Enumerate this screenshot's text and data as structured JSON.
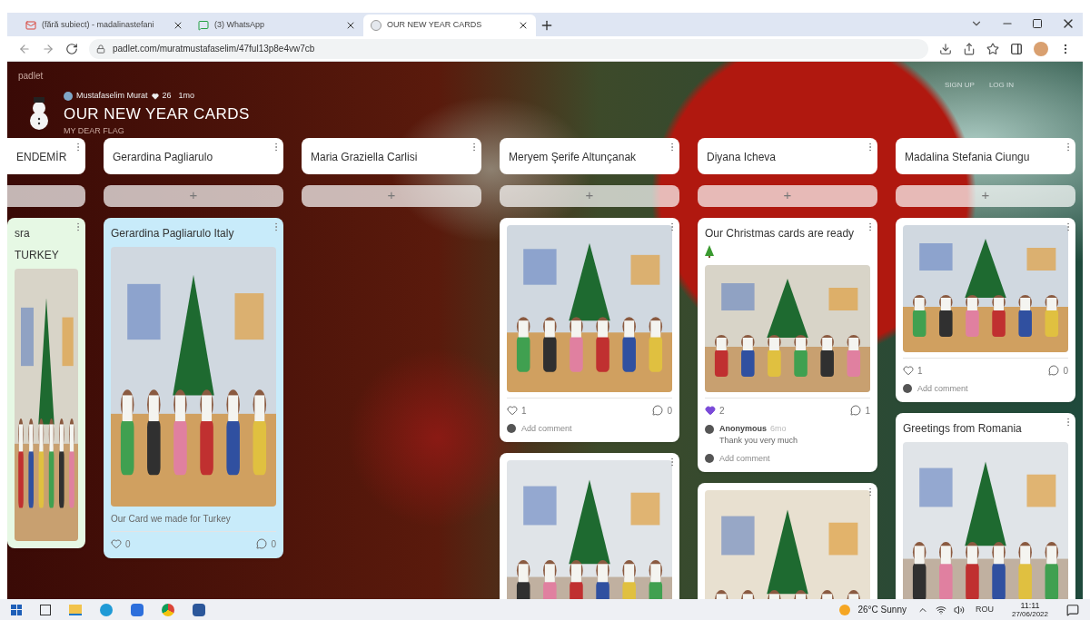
{
  "browser": {
    "tabs": [
      {
        "title": "(fără subiect) - madalinastefani",
        "selected": false,
        "kind": "mail"
      },
      {
        "title": "(3) WhatsApp",
        "selected": false,
        "kind": "chat"
      },
      {
        "title": "OUR NEW YEAR CARDS",
        "selected": true,
        "kind": "board"
      }
    ],
    "url": "padlet.com/muratmustafaselim/47ful13p8e4vw7cb"
  },
  "header": {
    "brand": "padlet",
    "author": "Mustafaselim Murat",
    "reactions": "26",
    "age": "1mo",
    "title": "OUR NEW YEAR CARDS",
    "subtitle": "MY DEAR FLAG",
    "actions": [
      "SIGN UP",
      "LOG IN"
    ]
  },
  "columns": [
    {
      "title": "ENDEMİR",
      "posts": [
        {
          "color": "#e6f8e4",
          "lines": [
            "sra",
            "TURKEY"
          ],
          "image": {
            "kind": "picture"
          }
        }
      ]
    },
    {
      "title": "Gerardina Pagliarulo",
      "add": "+",
      "posts": [
        {
          "color": "#c8ebfa",
          "title": "Gerardina Pagliarulo Italy",
          "image": {
            "kind": "picture"
          },
          "caption": "Our Card we made for Turkey",
          "likes": {
            "count": "0",
            "liked": false
          },
          "comments": "0"
        }
      ]
    },
    {
      "title": "Maria Graziella Carlisi",
      "add": "+"
    },
    {
      "title": "Meryem Şerife Altunçanak",
      "add": "+",
      "posts": [
        {
          "color": "#ffffff",
          "image": {
            "kind": "picture"
          },
          "likes": {
            "count": "1",
            "liked": false
          },
          "comments": "0",
          "add_comment": "Add comment"
        },
        {
          "color": "#ffffff",
          "image": {
            "kind": "picture"
          }
        }
      ]
    },
    {
      "title": "Diyana Icheva",
      "add": "+",
      "posts": [
        {
          "color": "#ffffff",
          "title": "Our Christmas cards are ready",
          "emoji": true,
          "image": {
            "kind": "picture"
          },
          "likes": {
            "count": "2",
            "liked": true
          },
          "comments": "1",
          "comment_list": [
            {
              "author": "Anonymous",
              "age": "6mo",
              "text": "Thank you very much"
            }
          ],
          "add_comment": "Add comment"
        },
        {
          "color": "#ffffff",
          "image": {
            "kind": "picture"
          }
        }
      ]
    },
    {
      "title": "Madalina Stefania Ciungu",
      "add": "+",
      "posts": [
        {
          "color": "#ffffff",
          "image": {
            "kind": "picture"
          },
          "likes": {
            "count": "1",
            "liked": false
          },
          "comments": "0",
          "add_comment": "Add comment"
        },
        {
          "color": "#ffffff",
          "title": "Greetings from Romania",
          "image": {
            "kind": "picture"
          }
        }
      ]
    }
  ],
  "taskbar": {
    "weather": "26°C Sunny",
    "language": "ROU",
    "time": "11:11",
    "date": "27/06/2022"
  }
}
